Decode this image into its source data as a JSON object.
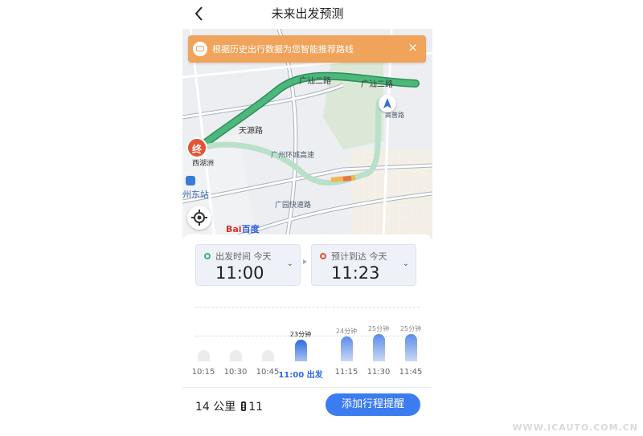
{
  "header": {
    "title": "未来出发预测"
  },
  "banner": {
    "text": "根据历史出行数据为您智能推荐路线",
    "close": "×"
  },
  "map": {
    "end_marker": "终",
    "station": "州东站",
    "logo_prefix": "Bai",
    "logo_suffix": "百度",
    "road_labels": [
      "广汕二路",
      "广汕二路",
      "天源路",
      "广州环城高速",
      "广园快速路",
      "高普路",
      "西湖洲"
    ]
  },
  "departure": {
    "label": "出发时间 今天",
    "time": "11:00"
  },
  "arrival": {
    "label": "预计到达 今天",
    "time": "11:23"
  },
  "chart_data": {
    "type": "bar",
    "categories": [
      "10:15",
      "10:30",
      "10:45",
      "11:00 出发",
      "11:15",
      "11:30",
      "11:45"
    ],
    "values": [
      null,
      null,
      null,
      23,
      24,
      25,
      25
    ],
    "value_labels": [
      "",
      "",
      "",
      "23分钟",
      "24分钟",
      "25分钟",
      "25分钟"
    ],
    "selected_index": 3
  },
  "footer": {
    "distance": "14 公里",
    "lights": "11",
    "button": "添加行程提醒"
  },
  "watermark": "WWW.ICAUTO.COM.CN",
  "colors": {
    "accent": "#3b7cf0",
    "banner": "#f0a35a",
    "route": "#3da56e",
    "end": "#e35336"
  }
}
